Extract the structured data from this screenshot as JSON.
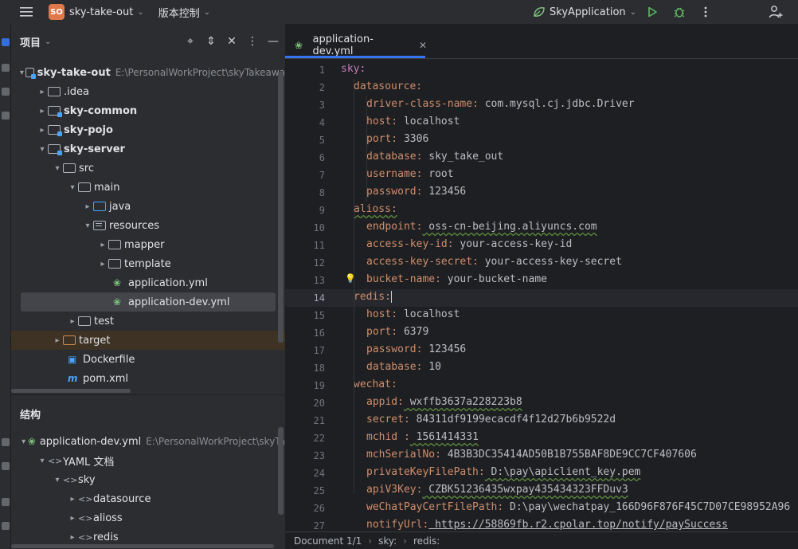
{
  "titlebar": {
    "project_badge": "SO",
    "project_name": "sky-take-out",
    "vcs_label": "版本控制",
    "run_config": "SkyApplication"
  },
  "project_panel": {
    "title": "项目",
    "tree": [
      {
        "label": "sky-take-out",
        "hint": "E:\\PersonalWorkProject\\skyTakeawa"
      },
      {
        "label": ".idea"
      },
      {
        "label": "sky-common"
      },
      {
        "label": "sky-pojo"
      },
      {
        "label": "sky-server"
      },
      {
        "label": "src"
      },
      {
        "label": "main"
      },
      {
        "label": "java"
      },
      {
        "label": "resources"
      },
      {
        "label": "mapper"
      },
      {
        "label": "template"
      },
      {
        "label": "application.yml"
      },
      {
        "label": "application-dev.yml"
      },
      {
        "label": "test"
      },
      {
        "label": "target"
      },
      {
        "label": "Dockerfile"
      },
      {
        "label": "pom.xml"
      }
    ]
  },
  "structure_panel": {
    "title": "结构",
    "tree": [
      {
        "label": "application-dev.yml",
        "hint": "E:\\PersonalWorkProject\\skyTa"
      },
      {
        "label": "YAML 文档"
      },
      {
        "label": "sky"
      },
      {
        "label": "datasource"
      },
      {
        "label": "alioss"
      },
      {
        "label": "redis"
      }
    ]
  },
  "editor": {
    "tab_label": "application-dev.yml",
    "current_line": 14,
    "lines": [
      {
        "n": "1",
        "indent": 0,
        "key": "sky:",
        "val": ""
      },
      {
        "n": "2",
        "indent": 1,
        "key": "datasource:",
        "val": ""
      },
      {
        "n": "3",
        "indent": 2,
        "key": "driver-class-name:",
        "val": " com.mysql.cj.jdbc.Driver"
      },
      {
        "n": "4",
        "indent": 2,
        "key": "host:",
        "val": " localhost"
      },
      {
        "n": "5",
        "indent": 2,
        "key": "port:",
        "val": " 3306"
      },
      {
        "n": "6",
        "indent": 2,
        "key": "database:",
        "val": " sky_take_out"
      },
      {
        "n": "7",
        "indent": 2,
        "key": "username:",
        "val": " root"
      },
      {
        "n": "8",
        "indent": 2,
        "key": "password:",
        "val": " 123456"
      },
      {
        "n": "9",
        "indent": 1,
        "key": "alioss:",
        "val": ""
      },
      {
        "n": "10",
        "indent": 2,
        "key": "endpoint:",
        "val": " oss-cn-beijing.aliyuncs.com"
      },
      {
        "n": "11",
        "indent": 2,
        "key": "access-key-id:",
        "val": " your-access-key-id"
      },
      {
        "n": "12",
        "indent": 2,
        "key": "access-key-secret:",
        "val": " your-access-key-secret"
      },
      {
        "n": "13",
        "indent": 2,
        "key": "bucket-name:",
        "val": " your-bucket-name"
      },
      {
        "n": "14",
        "indent": 1,
        "key": "redis:",
        "val": ""
      },
      {
        "n": "15",
        "indent": 2,
        "key": "host:",
        "val": " localhost"
      },
      {
        "n": "16",
        "indent": 2,
        "key": "port:",
        "val": " 6379"
      },
      {
        "n": "17",
        "indent": 2,
        "key": "password:",
        "val": " 123456"
      },
      {
        "n": "18",
        "indent": 2,
        "key": "database:",
        "val": " 10"
      },
      {
        "n": "19",
        "indent": 1,
        "key": "wechat:",
        "val": ""
      },
      {
        "n": "20",
        "indent": 2,
        "key": "appid:",
        "val": " wxffb3637a228223b8"
      },
      {
        "n": "21",
        "indent": 2,
        "key": "secret:",
        "val": " 84311df9199ecacdf4f12d27b6b9522d"
      },
      {
        "n": "22",
        "indent": 2,
        "key": "mchid :",
        "val": " 1561414331"
      },
      {
        "n": "23",
        "indent": 2,
        "key": "mchSerialNo:",
        "val": " 4B3B3DC35414AD50B1B755BAF8DE9CC7CF407606"
      },
      {
        "n": "24",
        "indent": 2,
        "key": "privateKeyFilePath:",
        "val": " D:\\pay\\apiclient_key.pem"
      },
      {
        "n": "25",
        "indent": 2,
        "key": "apiV3Key:",
        "val": " CZBK51236435wxpay435434323FFDuv3"
      },
      {
        "n": "26",
        "indent": 2,
        "key": "weChatPayCertFilePath:",
        "val": " D:\\pay\\wechatpay_166D96F876F45C7D07CE98952A96"
      },
      {
        "n": "27",
        "indent": 2,
        "key": "notifyUrl:",
        "val": " https://58869fb.r2.cpolar.top/notify/paySuccess"
      }
    ]
  },
  "statusbar": {
    "doc": "Document 1/1",
    "crumb1": "sky:",
    "crumb2": "redis:"
  },
  "colors": {
    "accent": "#3574f0",
    "key": "#cf8e6d",
    "badge": "#e0784a"
  },
  "icons": [
    "hamburger-menu-icon",
    "run-icon",
    "debug-icon",
    "more-icon",
    "add-user-icon",
    "crosshair-icon",
    "expand-collapse-icon",
    "close-icon",
    "minimize-icon",
    "yaml-file-icon",
    "folder-icon",
    "lightbulb-icon",
    "docker-icon",
    "maven-icon"
  ]
}
